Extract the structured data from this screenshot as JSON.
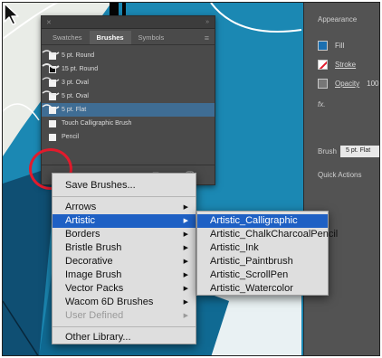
{
  "right_panel": {
    "appearance_label": "Appearance",
    "fill_label": "Fill",
    "stroke_label": "Stroke",
    "opacity_label": "Opacity",
    "opacity_value": "100",
    "fx_label": "fx.",
    "brush_label": "Brush",
    "brush_value": "5 pt. Flat",
    "quick_actions_label": "Quick Actions"
  },
  "brushes_panel": {
    "tabs": [
      "Swatches",
      "Brushes",
      "Symbols"
    ],
    "active_tab": "Brushes",
    "items": [
      {
        "label": "5 pt. Round",
        "icon": "round-brush-icon"
      },
      {
        "label": "15 pt. Round",
        "icon": "round-brush-icon"
      },
      {
        "label": "3 pt. Oval",
        "icon": "oval-brush-icon"
      },
      {
        "label": "5 pt. Oval",
        "icon": "oval-brush-icon"
      },
      {
        "label": "5 pt. Flat",
        "icon": "flat-brush-icon",
        "selected": true
      },
      {
        "label": "Touch Calligraphic Brush",
        "icon": "calligraphic-brush-icon"
      },
      {
        "label": "Pencil",
        "icon": "pencil-brush-icon"
      }
    ]
  },
  "brush_library_menu": {
    "items": [
      {
        "label": "Save Brushes...",
        "type": "item"
      },
      {
        "type": "separator"
      },
      {
        "label": "Arrows",
        "type": "submenu"
      },
      {
        "label": "Artistic",
        "type": "submenu",
        "highlighted": true
      },
      {
        "label": "Borders",
        "type": "submenu"
      },
      {
        "label": "Bristle Brush",
        "type": "submenu"
      },
      {
        "label": "Decorative",
        "type": "submenu"
      },
      {
        "label": "Image Brush",
        "type": "submenu"
      },
      {
        "label": "Vector Packs",
        "type": "submenu"
      },
      {
        "label": "Wacom 6D Brushes",
        "type": "submenu"
      },
      {
        "label": "User Defined",
        "type": "submenu",
        "disabled": true
      },
      {
        "type": "separator"
      },
      {
        "label": "Other Library...",
        "type": "item"
      }
    ]
  },
  "artistic_submenu": {
    "items": [
      {
        "label": "Artistic_Calligraphic",
        "highlighted": true
      },
      {
        "label": "Artistic_ChalkCharcoalPencil"
      },
      {
        "label": "Artistic_Ink"
      },
      {
        "label": "Artistic_Paintbrush"
      },
      {
        "label": "Artistic_ScrollPen"
      },
      {
        "label": "Artistic_Watercolor"
      }
    ]
  },
  "colors": {
    "canvas_blue": "#1b88b3",
    "panel_bg": "#4a4a4a",
    "menu_bg": "#dedede",
    "menu_highlight": "#1e60c4",
    "callout_red": "#e21b2c",
    "brush_selected": "#3f6d94"
  }
}
